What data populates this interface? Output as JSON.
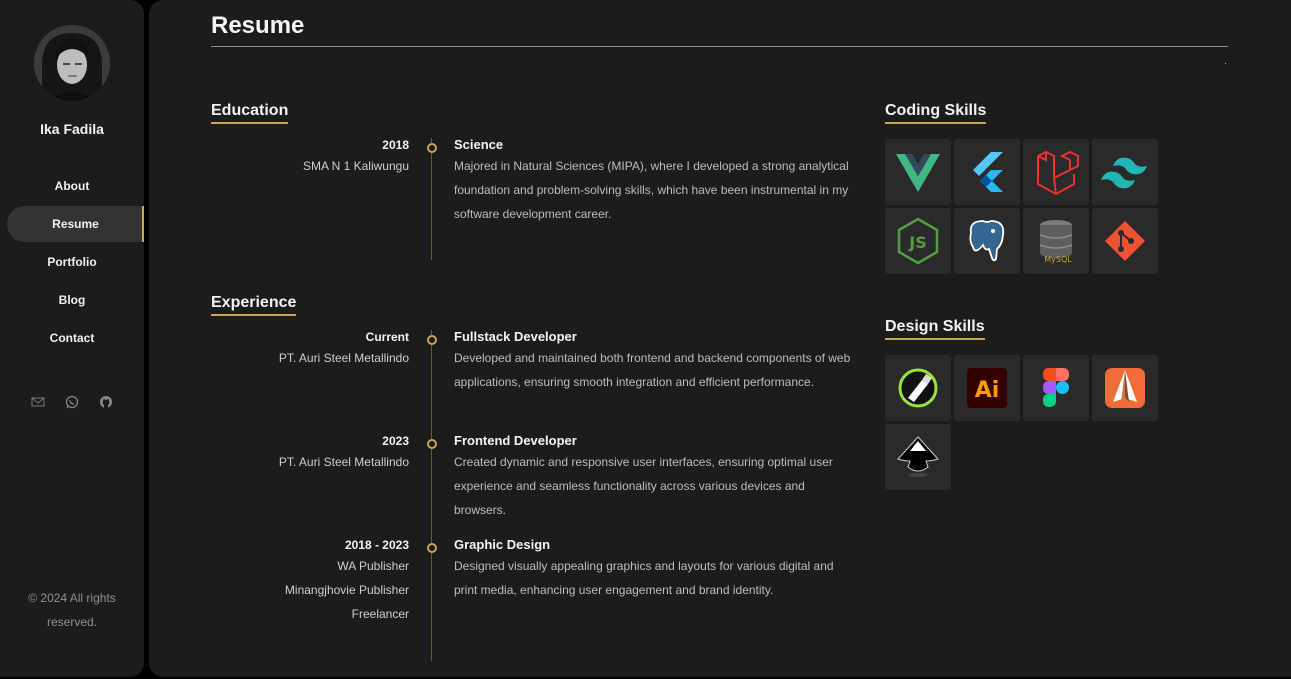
{
  "sidebar": {
    "name": "Ika Fadila",
    "nav": [
      "About",
      "Resume",
      "Portfolio",
      "Blog",
      "Contact"
    ],
    "active_nav": "Resume",
    "copyright": "© 2024 All rights reserved."
  },
  "main": {
    "title": "Resume",
    "education": {
      "title": "Education",
      "entries": [
        {
          "date": "2018",
          "orgs": [
            "SMA N 1 Kaliwungu"
          ],
          "role": "Science",
          "desc": "Majored in Natural Sciences (MIPA), where I developed a strong analytical foundation and problem-solving skills, which have been instrumental in my software development career."
        }
      ]
    },
    "experience": {
      "title": "Experience",
      "entries": [
        {
          "date": "Current",
          "orgs": [
            "PT. Auri Steel Metallindo"
          ],
          "role": "Fullstack Developer",
          "desc": "Developed and maintained both frontend and backend components of web applications, ensuring smooth integration and efficient performance."
        },
        {
          "date": "2023",
          "orgs": [
            "PT. Auri Steel Metallindo"
          ],
          "role": "Frontend Developer",
          "desc": "Created dynamic and responsive user interfaces, ensuring optimal user experience and seamless functionality across various devices and browsers."
        },
        {
          "date": "2018 - 2023",
          "orgs": [
            "WA Publisher",
            "Minangjhovie Publisher",
            "Freelancer"
          ],
          "role": "Graphic Design",
          "desc": "Designed visually appealing graphics and layouts for various digital and print media, enhancing user engagement and brand identity."
        }
      ]
    },
    "coding_skills": {
      "title": "Coding Skills",
      "icons": [
        "vue-icon",
        "flutter-icon",
        "laravel-icon",
        "tailwind-icon",
        "nodejs-icon",
        "postgresql-icon",
        "mysql-icon",
        "git-icon"
      ]
    },
    "design_skills": {
      "title": "Design Skills",
      "icons": [
        "corel-draw-icon",
        "illustrator-icon",
        "figma-icon",
        "sketchbook-icon",
        "inkscape-icon"
      ]
    }
  },
  "colors": {
    "accent": "#c9a64d",
    "panel": "#1c1c1c",
    "tile": "#2a2a2a"
  }
}
